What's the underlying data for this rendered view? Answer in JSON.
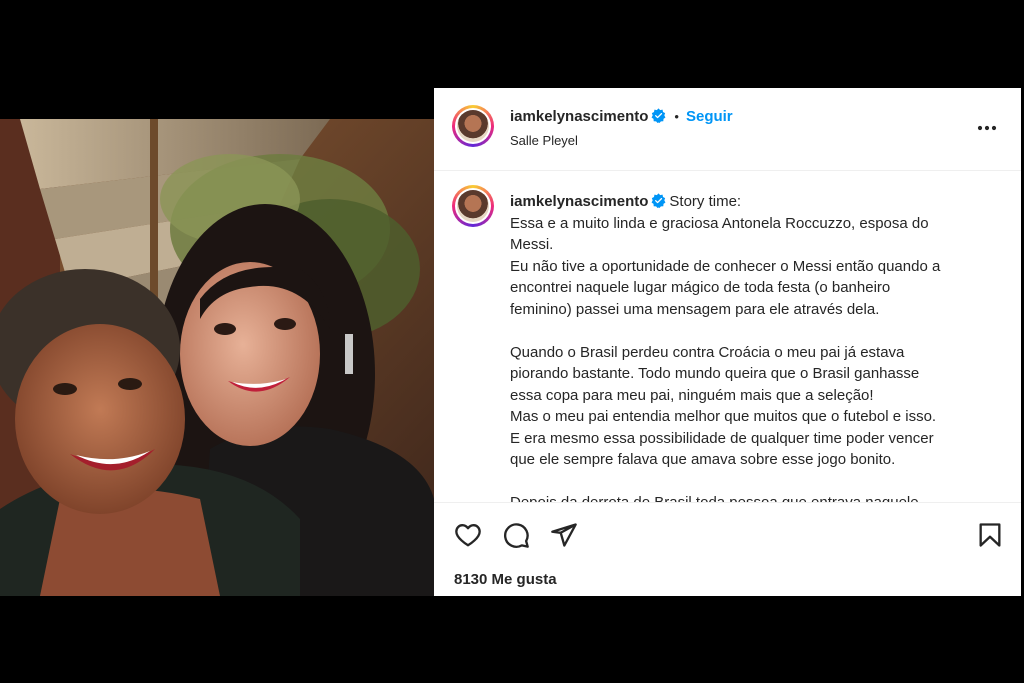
{
  "post": {
    "username": "iamkelynascimento",
    "follow_label": "Seguir",
    "separator": "•",
    "location": "Salle Pleyel",
    "caption": {
      "username": "iamkelynascimento",
      "first_line": "Story time:",
      "paragraphs": [
        [
          "Essa e a muito linda e graciosa Antonela Roccuzzo, esposa do",
          "Messi.",
          "Eu não tive a oportunidade de conhecer o Messi então quando a",
          "encontrei naquele lugar mágico de toda festa (o banheiro",
          "feminino) passei uma mensagem para ele através dela."
        ],
        [
          "Quando o Brasil perdeu contra Croácia o meu pai já estava",
          "piorando bastante. Todo mundo queira que o Brasil ganhasse",
          "essa copa para meu pai, ninguém mais que a seleção!",
          "Mas o meu pai entendia melhor que muitos que o futebol e isso.",
          "E era mesmo essa possibilidade de qualquer time poder vencer",
          "que ele sempre falava que amava sobre esse jogo bonito."
        ],
        [
          "Depois da derrota do Brasil toda pessoa que entrava naquele"
        ]
      ]
    },
    "likes_text": "8130 Me gusta",
    "icons": {
      "verified": "verified-badge-icon",
      "more": "more-options-icon",
      "like": "heart-icon",
      "comment": "comment-icon",
      "share": "send-icon",
      "save": "bookmark-icon"
    },
    "colors": {
      "follow": "#0095f6",
      "verified": "#0095f6",
      "text": "#262626"
    }
  }
}
